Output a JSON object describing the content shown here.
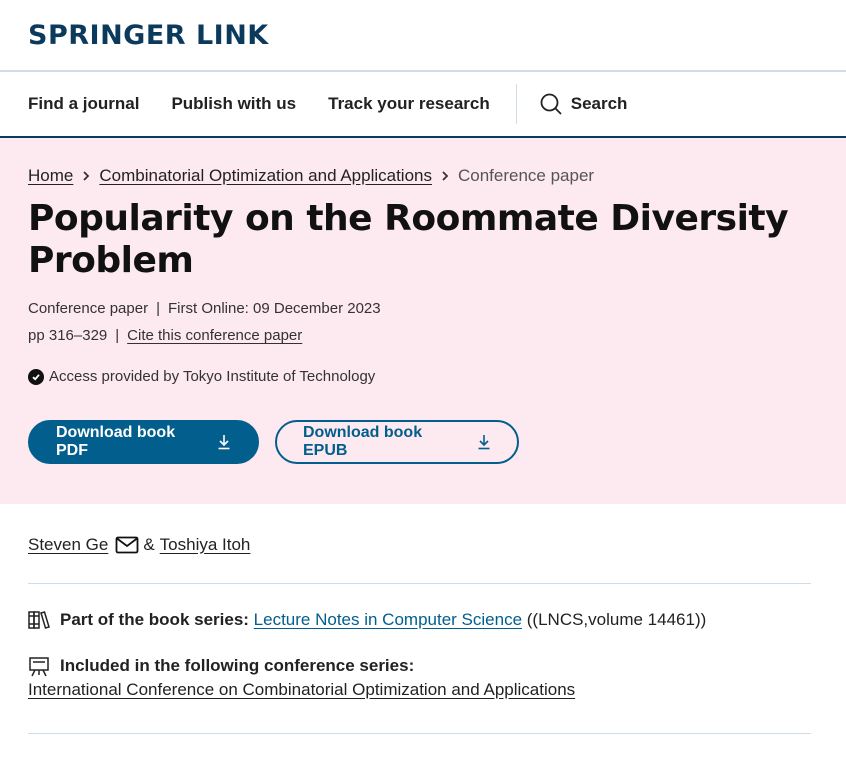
{
  "header": {
    "logo": "SPRINGER LINK"
  },
  "nav": {
    "items": [
      "Find a journal",
      "Publish with us",
      "Track your research"
    ],
    "search_label": "Search",
    "search_icon": "search-icon"
  },
  "breadcrumb": {
    "home": "Home",
    "parent": "Combinatorial Optimization and Applications",
    "current": "Conference paper"
  },
  "article": {
    "title": "Popularity on the Roommate Diversity Problem",
    "type": "Conference paper",
    "first_online": "First Online: 09 December 2023",
    "pages": "pp 316–329",
    "cite_label": "Cite this conference paper",
    "access_text": "Access provided by Tokyo Institute of Technology"
  },
  "buttons": {
    "download_pdf": "Download book PDF",
    "download_epub": "Download book EPUB"
  },
  "authors": {
    "first": "Steven Ge",
    "separator": "&",
    "second": "Toshiya Itoh"
  },
  "book_series": {
    "label": "Part of the book series:",
    "link": "Lecture Notes in Computer Science",
    "suffix": "((LNCS,volume 14461))"
  },
  "conference_series": {
    "label": "Included in the following conference series:",
    "link": "International Conference on Combinatorial Optimization and Applications"
  },
  "colors": {
    "brand": "#0c3a5c",
    "accent": "#025e8d",
    "hero_background": "#fde9f0"
  }
}
